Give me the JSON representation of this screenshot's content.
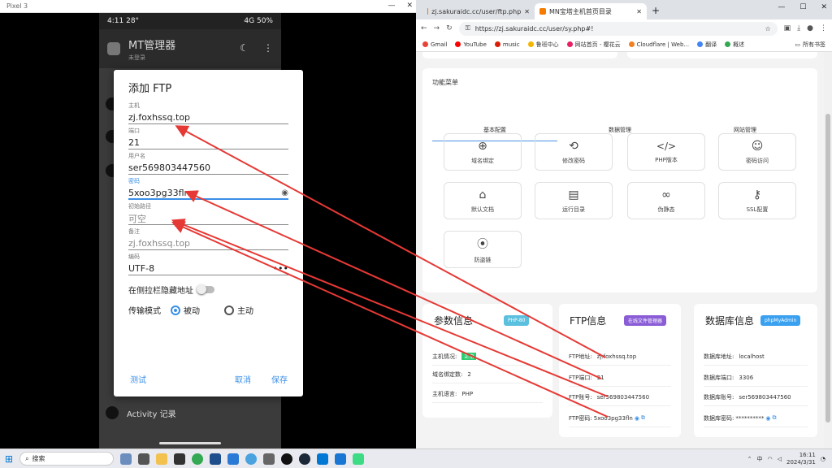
{
  "emulator": {
    "title": "Pixel 3"
  },
  "phone": {
    "status": {
      "time": "4:11",
      "temp": "28°",
      "net": "4G",
      "battery": "50%"
    },
    "app_title": "MT管理器",
    "app_subtitle": "未登录",
    "bg_items": [
      {
        "label": "Activity 记录"
      }
    ]
  },
  "dialog": {
    "title": "添加 FTP",
    "fields": [
      {
        "label": "主机",
        "value": "zj.foxhssq.top"
      },
      {
        "label": "端口",
        "value": "21"
      },
      {
        "label": "用户名",
        "value": "ser569803447560"
      },
      {
        "label": "密码",
        "value": "5xoo3pg33fln"
      },
      {
        "label": "初始路径",
        "value": "可空"
      },
      {
        "label": "备注",
        "value": "zj.foxhssq.top"
      },
      {
        "label": "编码",
        "value": "UTF-8"
      }
    ],
    "hide_sidebar_label": "在侧拉栏隐藏地址",
    "transfer_mode_label": "传输模式",
    "mode_passive": "被动",
    "mode_active": "主动",
    "test": "测试",
    "cancel": "取消",
    "save": "保存"
  },
  "browser": {
    "tabs": [
      {
        "title": "zj.sakuraidc.cc/user/ftp.php"
      },
      {
        "title": "MN宝塔主机首页目录"
      }
    ],
    "url": "https://zj.sakuraidc.cc/user/sy.php#!",
    "bookmarks": [
      {
        "label": "Gmail",
        "color": "#ea4335"
      },
      {
        "label": "YouTube",
        "color": "#ff0000"
      },
      {
        "label": "music",
        "color": "#d81e06"
      },
      {
        "label": "鲁班中心",
        "color": "#f4b400"
      },
      {
        "label": "网站首页 - 樱花云",
        "color": "#e91e63"
      },
      {
        "label": "Cloudflare | Web...",
        "color": "#f38020"
      },
      {
        "label": "翻译",
        "color": "#4285f4"
      },
      {
        "label": "概述",
        "color": "#34a853"
      }
    ],
    "all_bookmarks": "所有书签"
  },
  "page": {
    "menu_title": "功能菜单",
    "menu_tabs": [
      "基本配置",
      "数据管理",
      "网站管理"
    ],
    "buttons": [
      {
        "label": "域名绑定",
        "icon": "globe-icon"
      },
      {
        "label": "修改密码",
        "icon": "password-icon"
      },
      {
        "label": "PHP版本",
        "icon": "code-icon"
      },
      {
        "label": "密码访问",
        "icon": "mask-icon"
      },
      {
        "label": "默认文档",
        "icon": "home-icon"
      },
      {
        "label": "运行目录",
        "icon": "folder-icon"
      },
      {
        "label": "伪静态",
        "icon": "link-icon"
      },
      {
        "label": "SSL配置",
        "icon": "key-icon"
      },
      {
        "label": "防盗链",
        "icon": "antenna-icon"
      }
    ],
    "params": {
      "title": "参数信息",
      "badge": "PHP-80",
      "rows": [
        {
          "k": "主机情况:",
          "v": "正常"
        },
        {
          "k": "域名绑定数:",
          "v": "2"
        },
        {
          "k": "主机语言:",
          "v": "PHP"
        }
      ]
    },
    "ftp": {
      "title": "FTP信息",
      "badge": "在线文件管理器",
      "rows": [
        {
          "k": "FTP地址:",
          "v": "zj.foxhssq.top"
        },
        {
          "k": "FTP端口:",
          "v": "21"
        },
        {
          "k": "FTP账号:",
          "v": "ser569803447560"
        },
        {
          "k": "FTP密码:",
          "v": "5xoo3pg33fln"
        }
      ]
    },
    "db": {
      "title": "数据库信息",
      "badge": "phpMyAdmin",
      "rows": [
        {
          "k": "数据库地址:",
          "v": "localhost"
        },
        {
          "k": "数据库端口:",
          "v": "3306"
        },
        {
          "k": "数据库账号:",
          "v": "ser569803447560"
        },
        {
          "k": "数据库密码:",
          "v": "**********"
        }
      ]
    }
  },
  "taskbar": {
    "search": "搜索",
    "ime": "中",
    "time": "16:11",
    "date": "2024/3/31"
  },
  "colors": {
    "accent": "#3a8fe6",
    "arrow": "#e53935",
    "ftp_badge": "#8a5cd6",
    "db_badge": "#3aa0f0",
    "php_badge": "#5bc0de"
  }
}
